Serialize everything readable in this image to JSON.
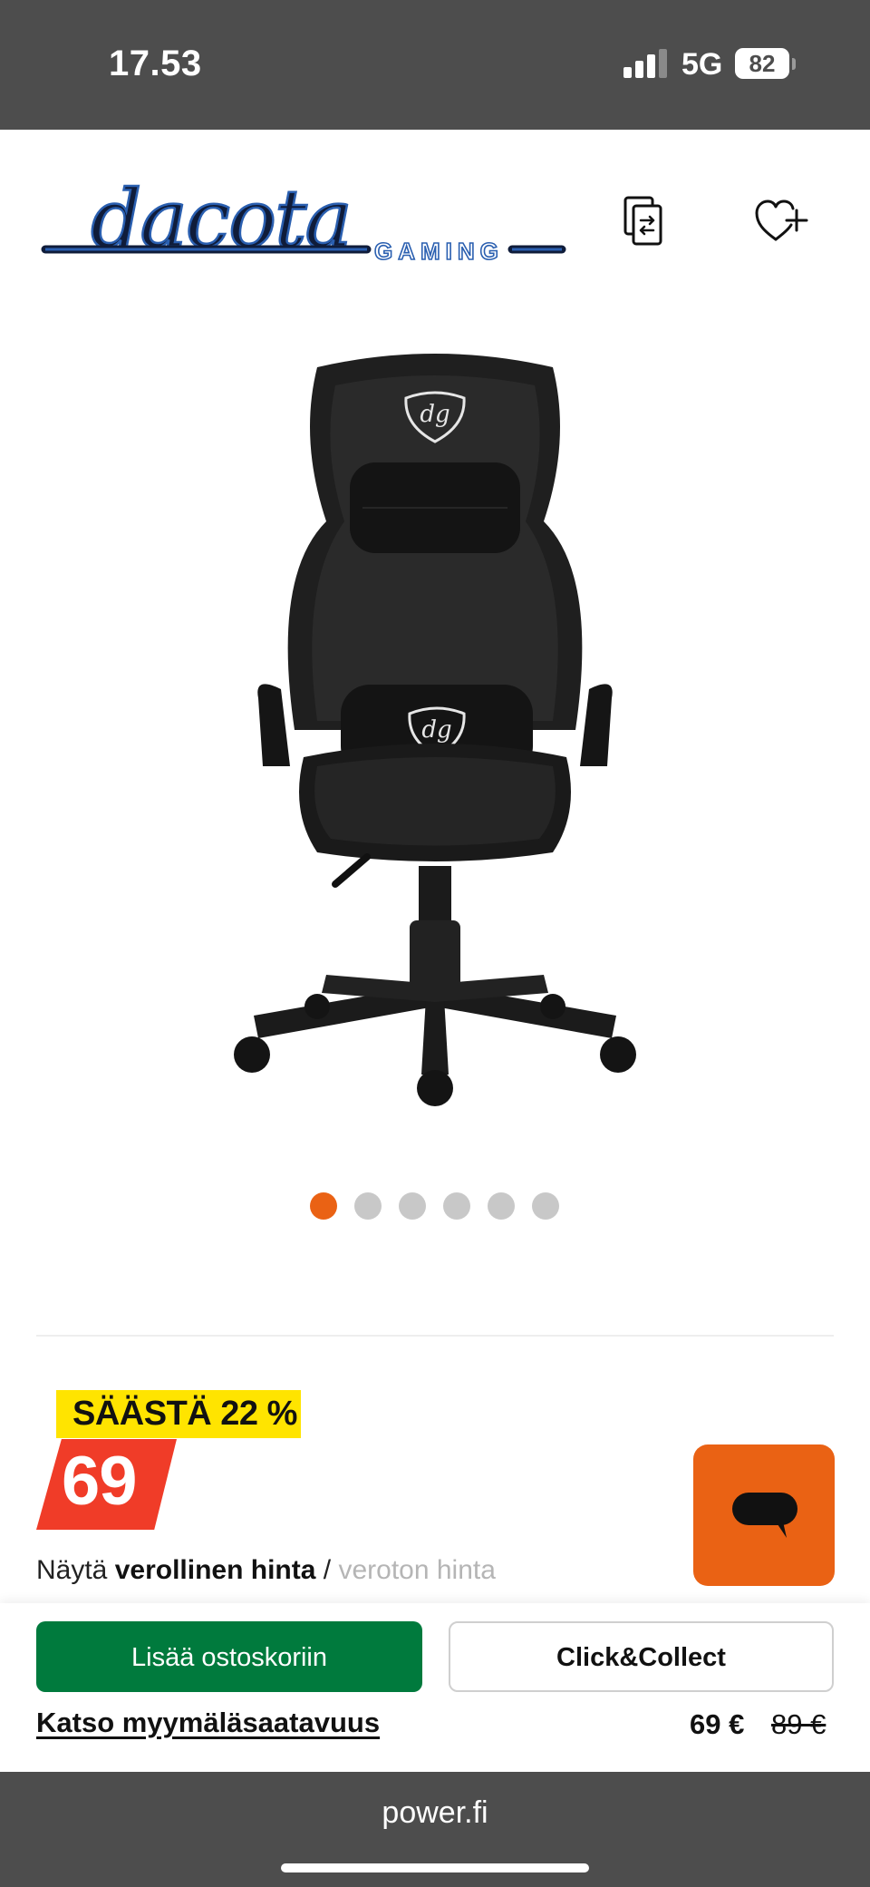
{
  "status_bar": {
    "time": "17.53",
    "network": "5G",
    "battery": "82"
  },
  "header": {
    "logo_main": "dacota",
    "logo_sub": "GAMING",
    "icons": [
      "compare-icon",
      "heart-plus-icon"
    ]
  },
  "carousel": {
    "total": 6,
    "active": 1
  },
  "pricing": {
    "save_badge": "SÄÄSTÄ 22 %",
    "price_badge": "69",
    "tax_prefix": "Näytä",
    "tax_incl": "verollinen hinta",
    "tax_sep": "/",
    "tax_excl": "veroton hinta"
  },
  "actions": {
    "add_to_cart": "Lisää ostoskoriin",
    "click_collect": "Click&Collect",
    "store_availability": "Katso myymäläsaatavuus",
    "price_now": "69 €",
    "price_old": "89 €"
  },
  "browser": {
    "url": "power.fi"
  },
  "colors": {
    "accent": "#ea6214",
    "primary_button": "#007a3d",
    "save_badge": "#ffe400",
    "price_badge": "#f03c28",
    "chrome": "#4d4d4d"
  }
}
